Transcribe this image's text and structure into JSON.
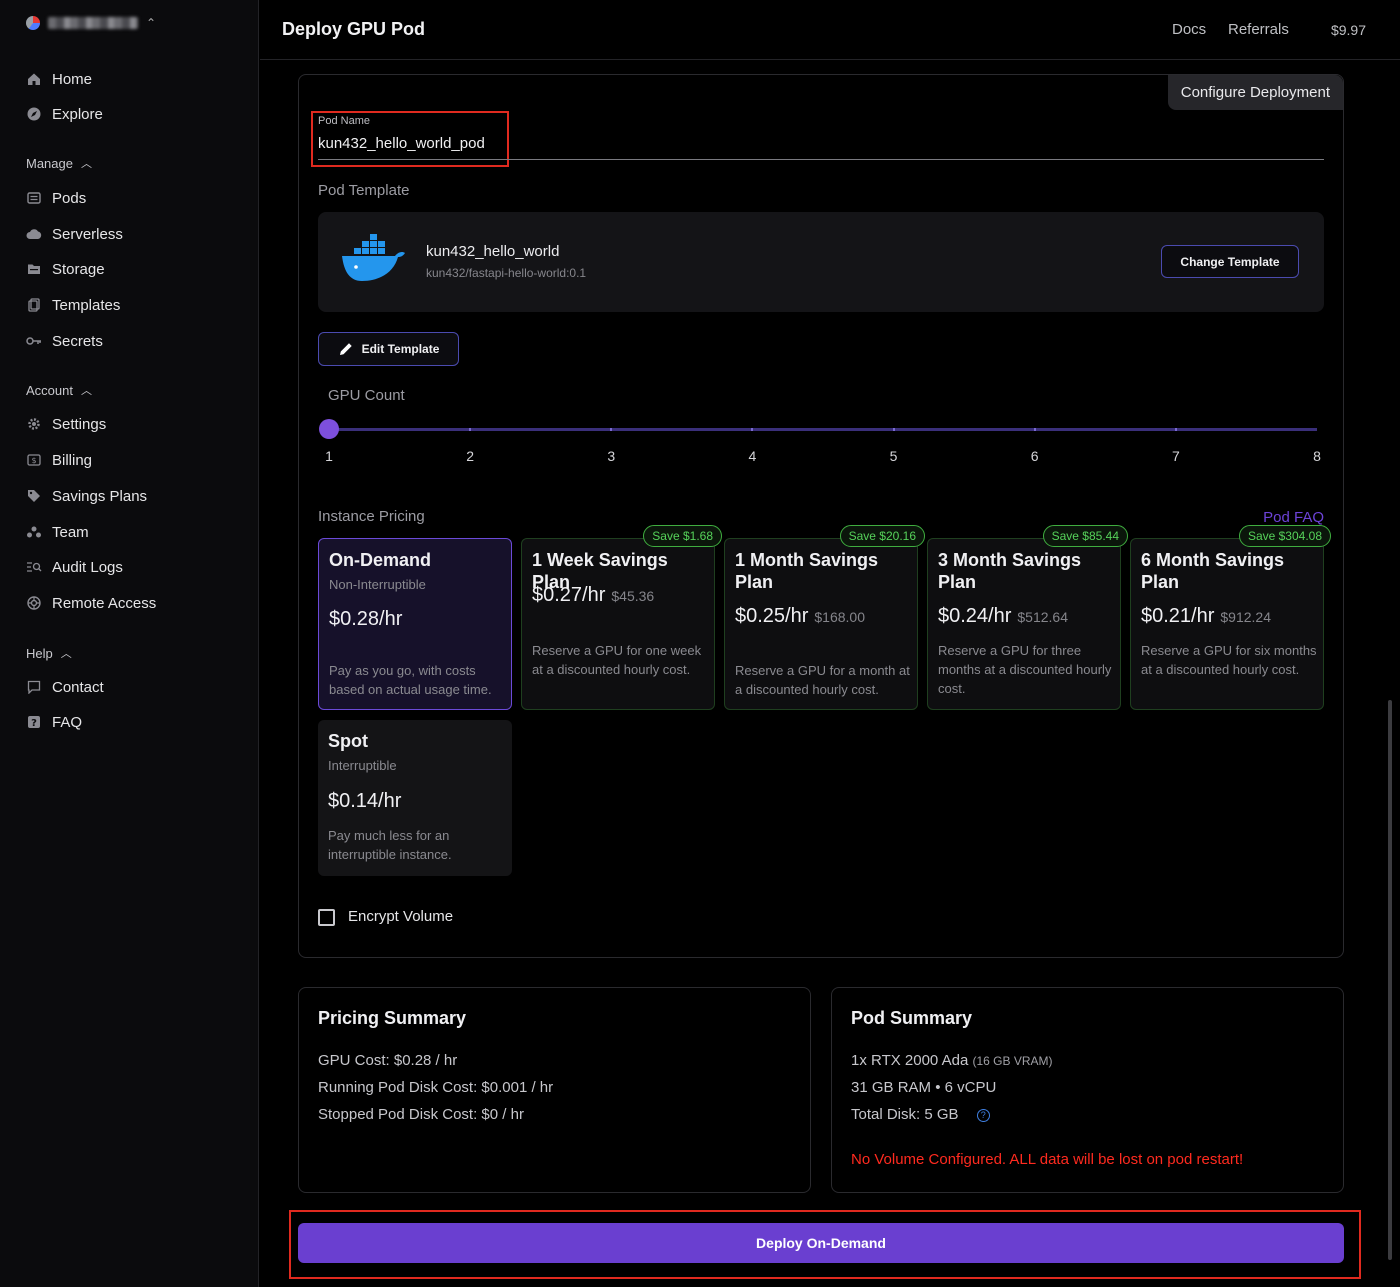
{
  "header": {
    "title": "Deploy GPU Pod",
    "links": [
      "Docs",
      "Referrals"
    ],
    "balance": "$9.97"
  },
  "sidebar": {
    "top_items": [
      {
        "label": "Home",
        "icon": "home-icon"
      },
      {
        "label": "Explore",
        "icon": "compass-icon"
      }
    ],
    "sections": [
      {
        "title": "Manage",
        "items": [
          {
            "label": "Pods",
            "icon": "pods-icon"
          },
          {
            "label": "Serverless",
            "icon": "cloud-icon"
          },
          {
            "label": "Storage",
            "icon": "folder-icon"
          },
          {
            "label": "Templates",
            "icon": "templates-icon"
          },
          {
            "label": "Secrets",
            "icon": "key-icon"
          }
        ]
      },
      {
        "title": "Account",
        "items": [
          {
            "label": "Settings",
            "icon": "gear-icon"
          },
          {
            "label": "Billing",
            "icon": "billing-icon"
          },
          {
            "label": "Savings Plans",
            "icon": "tag-icon"
          },
          {
            "label": "Team",
            "icon": "team-icon"
          },
          {
            "label": "Audit Logs",
            "icon": "audit-icon"
          },
          {
            "label": "Remote Access",
            "icon": "remote-icon"
          }
        ]
      },
      {
        "title": "Help",
        "items": [
          {
            "label": "Contact",
            "icon": "chat-icon"
          },
          {
            "label": "FAQ",
            "icon": "question-icon"
          }
        ]
      }
    ]
  },
  "config": {
    "tab_label": "Configure Deployment",
    "pod_name_label": "Pod Name",
    "pod_name_value": "kun432_hello_world_pod",
    "template_section": "Pod Template",
    "template_name": "kun432_hello_world",
    "template_image": "kun432/fastapi-hello-world:0.1",
    "change_template": "Change Template",
    "edit_template": "Edit Template",
    "gpu_count_label": "GPU Count",
    "gpu_count_value": 1,
    "gpu_count_options": [
      "1",
      "2",
      "3",
      "4",
      "5",
      "6",
      "7",
      "8"
    ],
    "instance_pricing_label": "Instance Pricing",
    "pod_faq": "Pod FAQ",
    "pricing_options": [
      {
        "title": "On-Demand",
        "subtitle": "Non-Interruptible",
        "price": "$0.28/hr",
        "total": "",
        "desc": "Pay as you go, with costs based on actual usage time.",
        "badge": "",
        "selected": true
      },
      {
        "title": "1 Week Savings Plan",
        "subtitle": "",
        "price": "$0.27/hr",
        "total": "$45.36",
        "desc": "Reserve a GPU for one week at a discounted hourly cost.",
        "badge": "Save $1.68",
        "selected": false
      },
      {
        "title": "1 Month Savings Plan",
        "subtitle": "",
        "price": "$0.25/hr",
        "total": "$168.00",
        "desc": "Reserve a GPU for a month at a discounted hourly cost.",
        "badge": "Save $20.16",
        "selected": false
      },
      {
        "title": "3 Month Savings Plan",
        "subtitle": "",
        "price": "$0.24/hr",
        "total": "$512.64",
        "desc": "Reserve a GPU for three months at a discounted hourly cost.",
        "badge": "Save $85.44",
        "selected": false
      },
      {
        "title": "6 Month Savings Plan",
        "subtitle": "",
        "price": "$0.21/hr",
        "total": "$912.24",
        "desc": "Reserve a GPU for six months at a discounted hourly cost.",
        "badge": "Save $304.08",
        "selected": false
      },
      {
        "title": "Spot",
        "subtitle": "Interruptible",
        "price": "$0.14/hr",
        "total": "",
        "desc": "Pay much less for an interruptible instance.",
        "badge": "",
        "selected": false
      }
    ],
    "encrypt_volume": "Encrypt Volume",
    "encrypt_checked": false
  },
  "pricing_summary": {
    "title": "Pricing Summary",
    "gpu_cost": "GPU Cost: $0.28 / hr",
    "running_disk": "Running Pod Disk Cost: $0.001 / hr",
    "stopped_disk": "Stopped Pod Disk Cost: $0 / hr"
  },
  "pod_summary": {
    "title": "Pod Summary",
    "gpu": "1x RTX 2000 Ada",
    "vram": "(16 GB VRAM)",
    "ram_cpu": "31 GB RAM • 6 vCPU",
    "disk": "Total Disk: 5 GB",
    "warning": "No Volume Configured. ALL data will be lost on pod restart!"
  },
  "deploy_button": "Deploy On-Demand",
  "colors": {
    "accent": "#6a3fd0",
    "save_green": "#56d25a",
    "warning_red": "#ff2a1f",
    "highlight_red": "#e02a1f"
  }
}
